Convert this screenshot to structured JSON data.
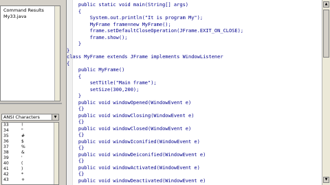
{
  "left_panel": {
    "tree_items": [
      "Command Results",
      "My33.java"
    ],
    "ansi_dropdown": "ANSI Characters",
    "ansi_rows": [
      {
        "code": "33",
        "ch": "!"
      },
      {
        "code": "34",
        "ch": "\""
      },
      {
        "code": "35",
        "ch": "#"
      },
      {
        "code": "36",
        "ch": "$"
      },
      {
        "code": "37",
        "ch": "%"
      },
      {
        "code": "38",
        "ch": "&"
      },
      {
        "code": "39",
        "ch": "'"
      },
      {
        "code": "40",
        "ch": "("
      },
      {
        "code": "41",
        "ch": ")"
      },
      {
        "code": "42",
        "ch": "*"
      },
      {
        "code": "43",
        "ch": "+"
      }
    ]
  },
  "editor": {
    "lines": [
      "    public static void main(String[] args)",
      "    {",
      "        System.out.println(\"It is program My\");",
      "        MyFrame frame=new MyFrame();",
      "        frame.setDefaultCloseOperation(JFrame.EXIT_ON_CLOSE);",
      "        frame.show();",
      "    }",
      "}",
      "class MyFrame extends JFrame implements WindowListener",
      "{",
      "    public MyFrame()",
      "    {",
      "        setTitle(\"Main frame\");",
      "        setSize(300,200);",
      "    }",
      "    public void windowOpened(WindowEvent e)",
      "    {}",
      "    public void windowClosing(WindowEvent e)",
      "    {}",
      "    public void windowClosed(WindowEvent e)",
      "    {}",
      "    public void windowIconified(WindowEvent e)",
      "    {}",
      "    public void windowDeiconified(WindowEvent e)",
      "    {}",
      "    public void windowActivated(WindowEvent e)",
      "    {}",
      "    public void windowDeactivated(WindowEvent e)"
    ]
  }
}
